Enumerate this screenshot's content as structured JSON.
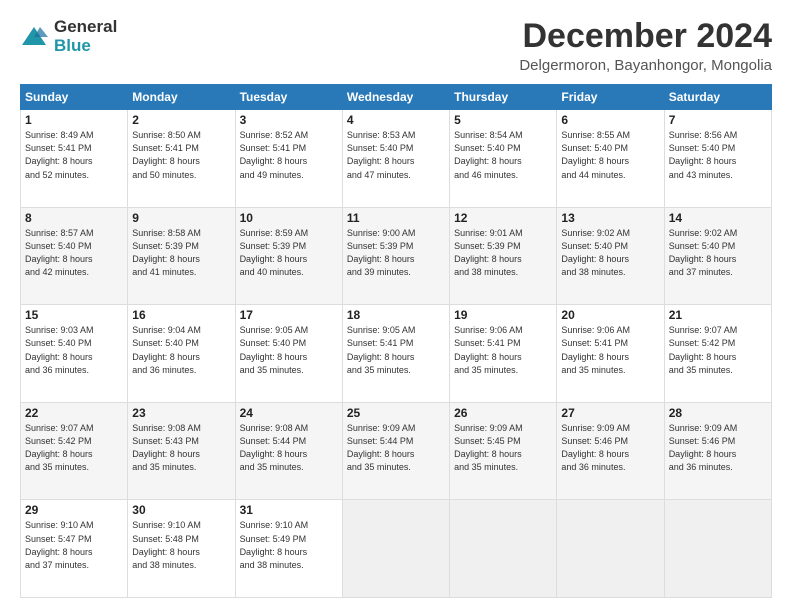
{
  "header": {
    "logo_line1": "General",
    "logo_line2": "Blue",
    "month": "December 2024",
    "location": "Delgermoron, Bayanhongor, Mongolia"
  },
  "weekdays": [
    "Sunday",
    "Monday",
    "Tuesday",
    "Wednesday",
    "Thursday",
    "Friday",
    "Saturday"
  ],
  "weeks": [
    [
      {
        "day": "1",
        "info": "Sunrise: 8:49 AM\nSunset: 5:41 PM\nDaylight: 8 hours\nand 52 minutes."
      },
      {
        "day": "2",
        "info": "Sunrise: 8:50 AM\nSunset: 5:41 PM\nDaylight: 8 hours\nand 50 minutes."
      },
      {
        "day": "3",
        "info": "Sunrise: 8:52 AM\nSunset: 5:41 PM\nDaylight: 8 hours\nand 49 minutes."
      },
      {
        "day": "4",
        "info": "Sunrise: 8:53 AM\nSunset: 5:40 PM\nDaylight: 8 hours\nand 47 minutes."
      },
      {
        "day": "5",
        "info": "Sunrise: 8:54 AM\nSunset: 5:40 PM\nDaylight: 8 hours\nand 46 minutes."
      },
      {
        "day": "6",
        "info": "Sunrise: 8:55 AM\nSunset: 5:40 PM\nDaylight: 8 hours\nand 44 minutes."
      },
      {
        "day": "7",
        "info": "Sunrise: 8:56 AM\nSunset: 5:40 PM\nDaylight: 8 hours\nand 43 minutes."
      }
    ],
    [
      {
        "day": "8",
        "info": "Sunrise: 8:57 AM\nSunset: 5:40 PM\nDaylight: 8 hours\nand 42 minutes."
      },
      {
        "day": "9",
        "info": "Sunrise: 8:58 AM\nSunset: 5:39 PM\nDaylight: 8 hours\nand 41 minutes."
      },
      {
        "day": "10",
        "info": "Sunrise: 8:59 AM\nSunset: 5:39 PM\nDaylight: 8 hours\nand 40 minutes."
      },
      {
        "day": "11",
        "info": "Sunrise: 9:00 AM\nSunset: 5:39 PM\nDaylight: 8 hours\nand 39 minutes."
      },
      {
        "day": "12",
        "info": "Sunrise: 9:01 AM\nSunset: 5:39 PM\nDaylight: 8 hours\nand 38 minutes."
      },
      {
        "day": "13",
        "info": "Sunrise: 9:02 AM\nSunset: 5:40 PM\nDaylight: 8 hours\nand 38 minutes."
      },
      {
        "day": "14",
        "info": "Sunrise: 9:02 AM\nSunset: 5:40 PM\nDaylight: 8 hours\nand 37 minutes."
      }
    ],
    [
      {
        "day": "15",
        "info": "Sunrise: 9:03 AM\nSunset: 5:40 PM\nDaylight: 8 hours\nand 36 minutes."
      },
      {
        "day": "16",
        "info": "Sunrise: 9:04 AM\nSunset: 5:40 PM\nDaylight: 8 hours\nand 36 minutes."
      },
      {
        "day": "17",
        "info": "Sunrise: 9:05 AM\nSunset: 5:40 PM\nDaylight: 8 hours\nand 35 minutes."
      },
      {
        "day": "18",
        "info": "Sunrise: 9:05 AM\nSunset: 5:41 PM\nDaylight: 8 hours\nand 35 minutes."
      },
      {
        "day": "19",
        "info": "Sunrise: 9:06 AM\nSunset: 5:41 PM\nDaylight: 8 hours\nand 35 minutes."
      },
      {
        "day": "20",
        "info": "Sunrise: 9:06 AM\nSunset: 5:41 PM\nDaylight: 8 hours\nand 35 minutes."
      },
      {
        "day": "21",
        "info": "Sunrise: 9:07 AM\nSunset: 5:42 PM\nDaylight: 8 hours\nand 35 minutes."
      }
    ],
    [
      {
        "day": "22",
        "info": "Sunrise: 9:07 AM\nSunset: 5:42 PM\nDaylight: 8 hours\nand 35 minutes."
      },
      {
        "day": "23",
        "info": "Sunrise: 9:08 AM\nSunset: 5:43 PM\nDaylight: 8 hours\nand 35 minutes."
      },
      {
        "day": "24",
        "info": "Sunrise: 9:08 AM\nSunset: 5:44 PM\nDaylight: 8 hours\nand 35 minutes."
      },
      {
        "day": "25",
        "info": "Sunrise: 9:09 AM\nSunset: 5:44 PM\nDaylight: 8 hours\nand 35 minutes."
      },
      {
        "day": "26",
        "info": "Sunrise: 9:09 AM\nSunset: 5:45 PM\nDaylight: 8 hours\nand 35 minutes."
      },
      {
        "day": "27",
        "info": "Sunrise: 9:09 AM\nSunset: 5:46 PM\nDaylight: 8 hours\nand 36 minutes."
      },
      {
        "day": "28",
        "info": "Sunrise: 9:09 AM\nSunset: 5:46 PM\nDaylight: 8 hours\nand 36 minutes."
      }
    ],
    [
      {
        "day": "29",
        "info": "Sunrise: 9:10 AM\nSunset: 5:47 PM\nDaylight: 8 hours\nand 37 minutes."
      },
      {
        "day": "30",
        "info": "Sunrise: 9:10 AM\nSunset: 5:48 PM\nDaylight: 8 hours\nand 38 minutes."
      },
      {
        "day": "31",
        "info": "Sunrise: 9:10 AM\nSunset: 5:49 PM\nDaylight: 8 hours\nand 38 minutes."
      },
      {
        "day": "",
        "info": ""
      },
      {
        "day": "",
        "info": ""
      },
      {
        "day": "",
        "info": ""
      },
      {
        "day": "",
        "info": ""
      }
    ]
  ]
}
